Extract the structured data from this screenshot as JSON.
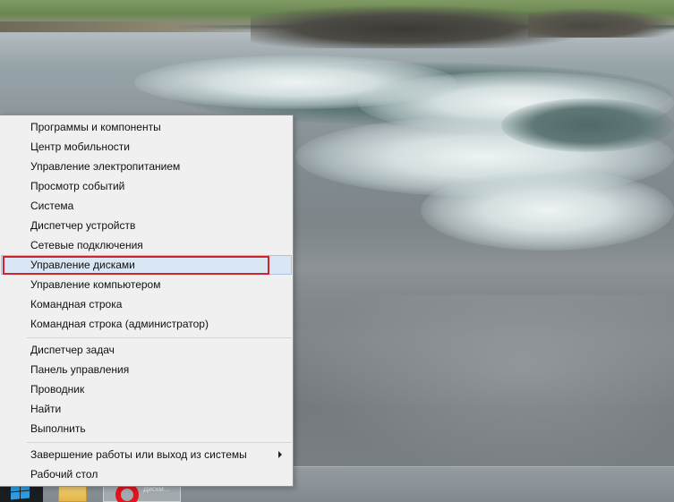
{
  "context_menu": {
    "group1": [
      "Программы и компоненты",
      "Центр мобильности",
      "Управление электропитанием",
      "Просмотр событий",
      "Система",
      "Диспетчер устройств",
      "Сетевые подключения",
      "Управление дисками",
      "Управление компьютером",
      "Командная строка",
      "Командная строка (администратор)"
    ],
    "group2": [
      "Диспетчер задач",
      "Панель управления",
      "Проводник",
      "Найти",
      "Выполнить"
    ],
    "group3": [
      "Завершение работы или выход из системы",
      "Рабочий стол"
    ],
    "selected_item": "Управление дисками",
    "highlight_color": "#d2232a",
    "selected_background": "#d9e6f4"
  },
  "taskbar": {
    "start_icon": "windows-logo-icon",
    "pinned": [
      {
        "icon": "file-explorer-icon"
      },
      {
        "icon": "opera-icon",
        "label": "Дискм..."
      }
    ],
    "accent_color": "#2d9be0"
  }
}
